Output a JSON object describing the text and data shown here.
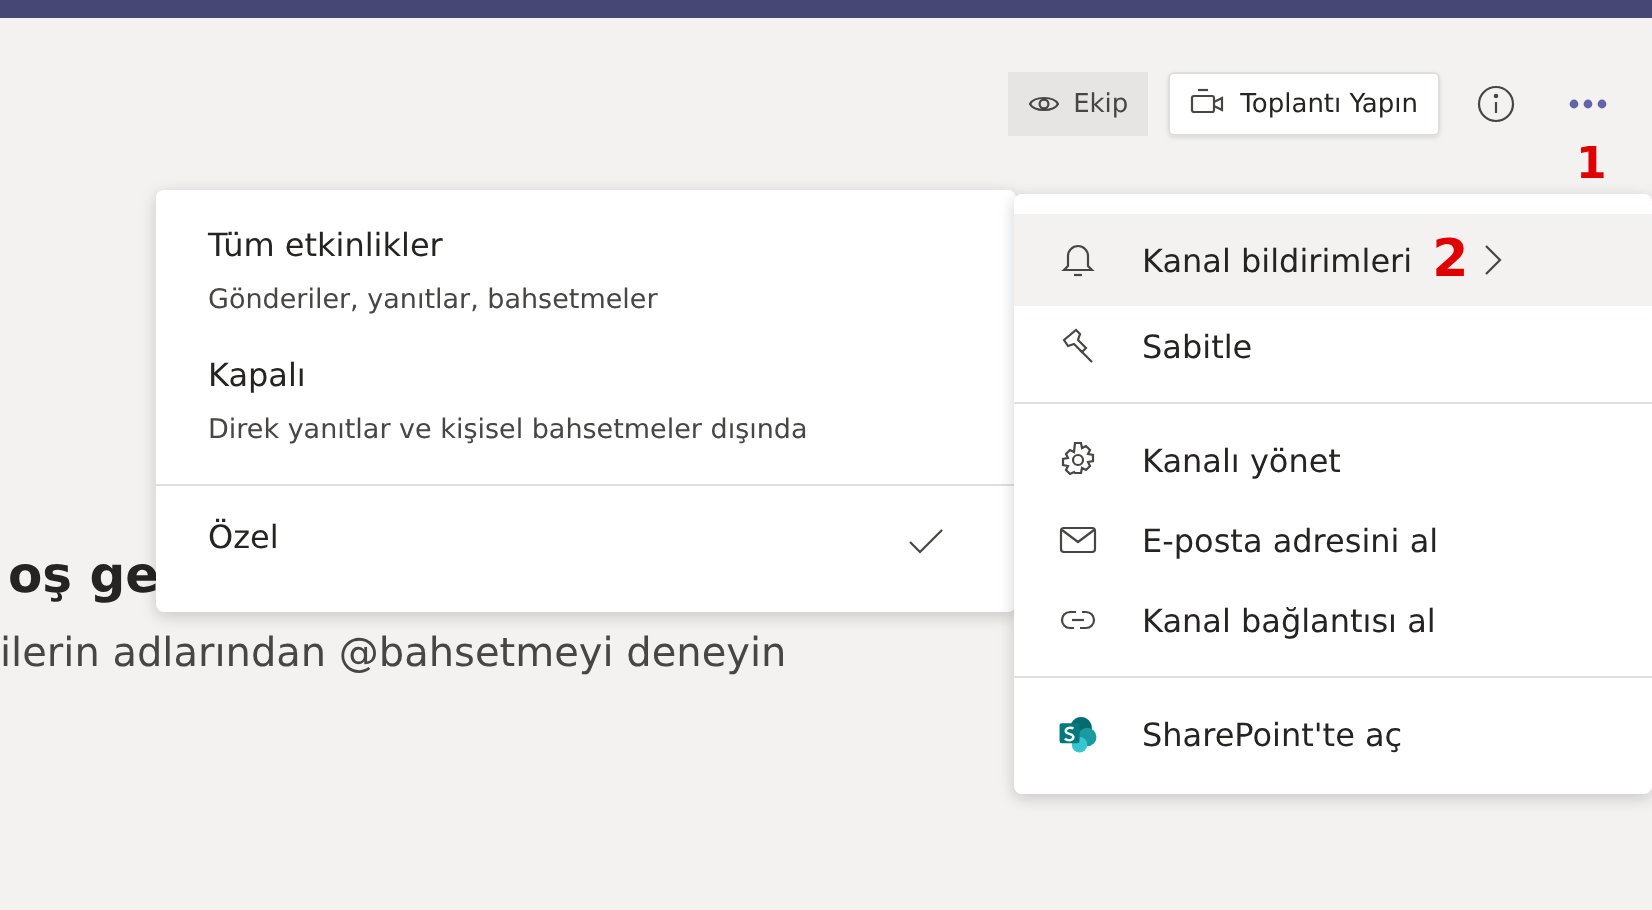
{
  "toolbar": {
    "buttons": [
      {
        "kind": "view",
        "label": "Ekip"
      },
      {
        "kind": "meeting",
        "label": "Toplantı Yapın"
      },
      {
        "kind": "info"
      },
      {
        "kind": "more"
      }
    ]
  },
  "content": {
    "heading": "oş ge",
    "text": "ilerin adlarından @bahsetmeyi deneyin"
  },
  "annotations": [
    {
      "text": "1"
    },
    {
      "text": "2"
    }
  ],
  "menu": {
    "items": [
      {
        "kind": "bell",
        "label": "Kanal bildirimleri",
        "highlighted": true,
        "submenu": true
      },
      {
        "kind": "pin",
        "label": "Sabitle",
        "highlighted": false,
        "submenu": false
      },
      {
        "kind": "divider"
      },
      {
        "kind": "gear",
        "label": "Kanalı yönet",
        "highlighted": false,
        "submenu": false
      },
      {
        "kind": "mail",
        "label": "E-posta adresini al",
        "highlighted": false,
        "submenu": false
      },
      {
        "kind": "link",
        "label": "Kanal bağlantısı al",
        "highlighted": false,
        "submenu": false
      },
      {
        "kind": "divider"
      },
      {
        "kind": "sharepoint",
        "label": "SharePoint'te aç",
        "highlighted": false,
        "submenu": false
      }
    ]
  },
  "submenu": {
    "items": [
      {
        "kind": "option",
        "title": "Tüm etkinlikler",
        "description": "Gönderiler, yanıtlar, bahsetmeler",
        "checked": false
      },
      {
        "kind": "option",
        "title": "Kapalı",
        "description": "Direk yanıtlar ve kişisel bahsetmeler dışında",
        "checked": false
      },
      {
        "kind": "divider"
      },
      {
        "kind": "option",
        "title": "Özel",
        "checked": true
      }
    ]
  }
}
